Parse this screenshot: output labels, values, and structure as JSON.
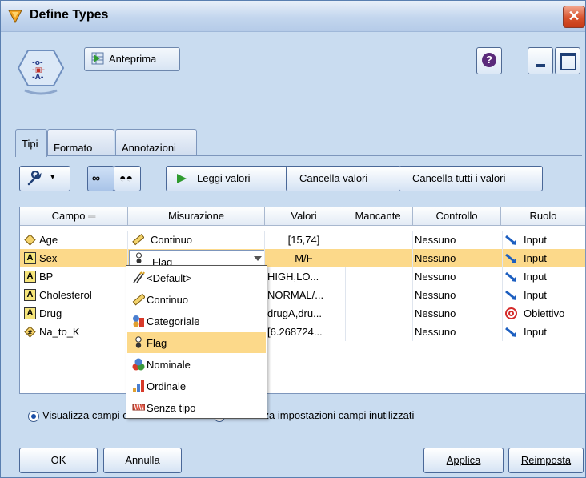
{
  "window": {
    "title": "Define Types",
    "close_symbol": "✕"
  },
  "header": {
    "preview_label": "Anteprima",
    "help_symbol": "?"
  },
  "tabs": [
    {
      "label": "Tipi"
    },
    {
      "label": "Formato"
    },
    {
      "label": "Annotazioni"
    }
  ],
  "toolbar": {
    "read_values": "Leggi valori",
    "clear_values": "Cancella valori",
    "clear_all_values": "Cancella tutti i valori"
  },
  "table": {
    "columns": [
      "Campo",
      "Misurazione",
      "Valori",
      "Mancante",
      "Controllo",
      "Ruolo"
    ],
    "rows": [
      {
        "field": "Age",
        "field_icon": "continuous-diamond-icon",
        "measurement": "Continuo",
        "measurement_icon": "ruler-icon",
        "values": "[15,74]",
        "missing": "",
        "check": "Nessuno",
        "role": "Input",
        "role_icon": "arrow-input-icon"
      },
      {
        "field": "Sex",
        "field_icon": "string-a-icon",
        "measurement": "Flag",
        "measurement_icon": "flag-icon",
        "values": "M/F",
        "missing": "",
        "check": "Nessuno",
        "role": "Input",
        "role_icon": "arrow-input-icon",
        "selected": true
      },
      {
        "field": "BP",
        "field_icon": "string-a-icon",
        "measurement": "",
        "values": "HIGH,LO...",
        "missing": "",
        "check": "Nessuno",
        "role": "Input",
        "role_icon": "arrow-input-icon"
      },
      {
        "field": "Cholesterol",
        "field_icon": "string-a-icon",
        "measurement": "",
        "values": "NORMAL/...",
        "missing": "",
        "check": "Nessuno",
        "role": "Input",
        "role_icon": "arrow-input-icon"
      },
      {
        "field": "Drug",
        "field_icon": "string-a-icon",
        "measurement": "",
        "values": "drugA,dru...",
        "missing": "",
        "check": "Nessuno",
        "role": "Obiettivo",
        "role_icon": "target-icon"
      },
      {
        "field": "Na_to_K",
        "field_icon": "number-diamond-icon",
        "measurement": "",
        "values": "[6.268724...",
        "missing": "",
        "check": "Nessuno",
        "role": "Input",
        "role_icon": "arrow-input-icon"
      }
    ]
  },
  "dropdown": {
    "items": [
      {
        "label": "<Default>",
        "icon": "default-wand-icon"
      },
      {
        "label": "Continuo",
        "icon": "ruler-icon"
      },
      {
        "label": "Categoriale",
        "icon": "categorical-icon"
      },
      {
        "label": "Flag",
        "icon": "flag-icon",
        "highlighted": true
      },
      {
        "label": "Nominale",
        "icon": "nominal-icon"
      },
      {
        "label": "Ordinale",
        "icon": "ordinal-icon"
      },
      {
        "label": "Senza tipo",
        "icon": "typeless-icon"
      }
    ]
  },
  "options": {
    "view_current": "Visualizza campi correnti",
    "view_unused": "Visualizza impostazioni campi inutilizzati"
  },
  "buttons": {
    "ok": "OK",
    "cancel": "Annulla",
    "apply": "Applica",
    "reset": "Reimposta"
  },
  "colors": {
    "selection": "#fcd98a",
    "window_bg": "#c9dcf0",
    "close_red": "#d8522c"
  }
}
